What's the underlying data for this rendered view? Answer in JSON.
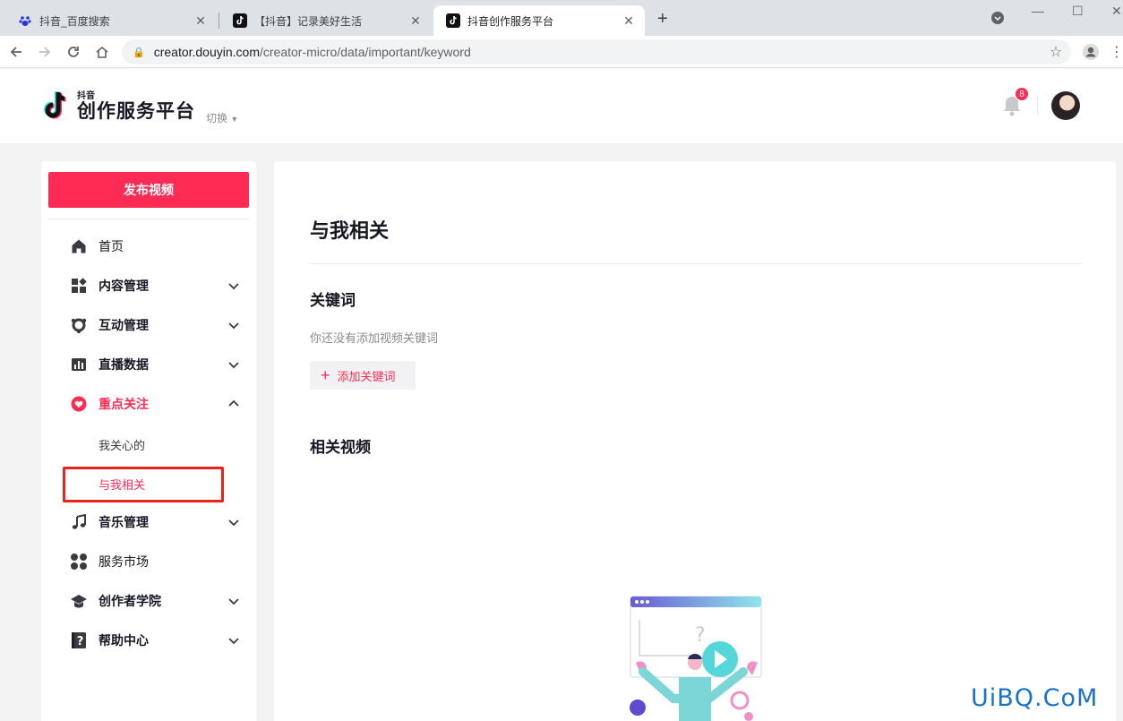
{
  "browser": {
    "tabs": [
      {
        "title": "抖音_百度搜索",
        "favicon": "baidu-paw-icon"
      },
      {
        "title": "【抖音】记录美好生活",
        "favicon": "douyin-icon"
      },
      {
        "title": "抖音创作服务平台",
        "favicon": "douyin-icon",
        "active": true
      }
    ],
    "new_tab": "+",
    "url_host": "creator.douyin.com",
    "url_path": "/creator-micro/data/important/keyword"
  },
  "header": {
    "logo_small": "抖音",
    "logo_big": "创作服务平台",
    "switch_label": "切换",
    "notification_count": "8"
  },
  "sidebar": {
    "publish_label": "发布视频",
    "items": [
      {
        "label": "首页",
        "icon": "home-icon",
        "expandable": false,
        "bold": false
      },
      {
        "label": "内容管理",
        "icon": "content-grid-icon",
        "expandable": true,
        "bold": true
      },
      {
        "label": "互动管理",
        "icon": "interaction-icon",
        "expandable": true,
        "bold": true
      },
      {
        "label": "直播数据",
        "icon": "bar-chart-icon",
        "expandable": true,
        "bold": true
      },
      {
        "label": "重点关注",
        "icon": "heart-icon",
        "expandable": true,
        "expanded": true,
        "bold": true,
        "active": true
      },
      {
        "label": "音乐管理",
        "icon": "music-note-icon",
        "expandable": true,
        "bold": true
      },
      {
        "label": "服务市场",
        "icon": "service-market-icon",
        "expandable": false,
        "bold": false
      },
      {
        "label": "创作者学院",
        "icon": "graduation-cap-icon",
        "expandable": true,
        "bold": true
      },
      {
        "label": "帮助中心",
        "icon": "help-question-icon",
        "expandable": true,
        "bold": true
      }
    ],
    "sub_items": [
      {
        "label": "我关心的",
        "active": false
      },
      {
        "label": "与我相关",
        "active": true
      }
    ]
  },
  "main": {
    "title": "与我相关",
    "keywords_title": "关键词",
    "empty_hint": "你还没有添加视频关键词",
    "add_button": "添加关键词",
    "related_videos_title": "相关视频"
  },
  "watermark": "UiBQ.CoM",
  "colors": {
    "accent": "#fe2c55",
    "highlight_box": "#e8231b"
  }
}
